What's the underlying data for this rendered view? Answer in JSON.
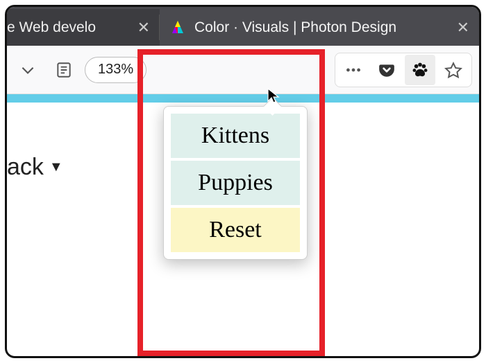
{
  "tabs": {
    "inactive": {
      "title": "e Web develo"
    },
    "active": {
      "title": "Color · Visuals | Photon Design"
    }
  },
  "toolbar": {
    "zoom": "133%"
  },
  "popup": {
    "items": {
      "kittens": "Kittens",
      "puppies": "Puppies",
      "reset": "Reset"
    }
  },
  "page": {
    "partial_label": "ack",
    "caret": "▼"
  },
  "icons": {
    "close": "✕"
  }
}
